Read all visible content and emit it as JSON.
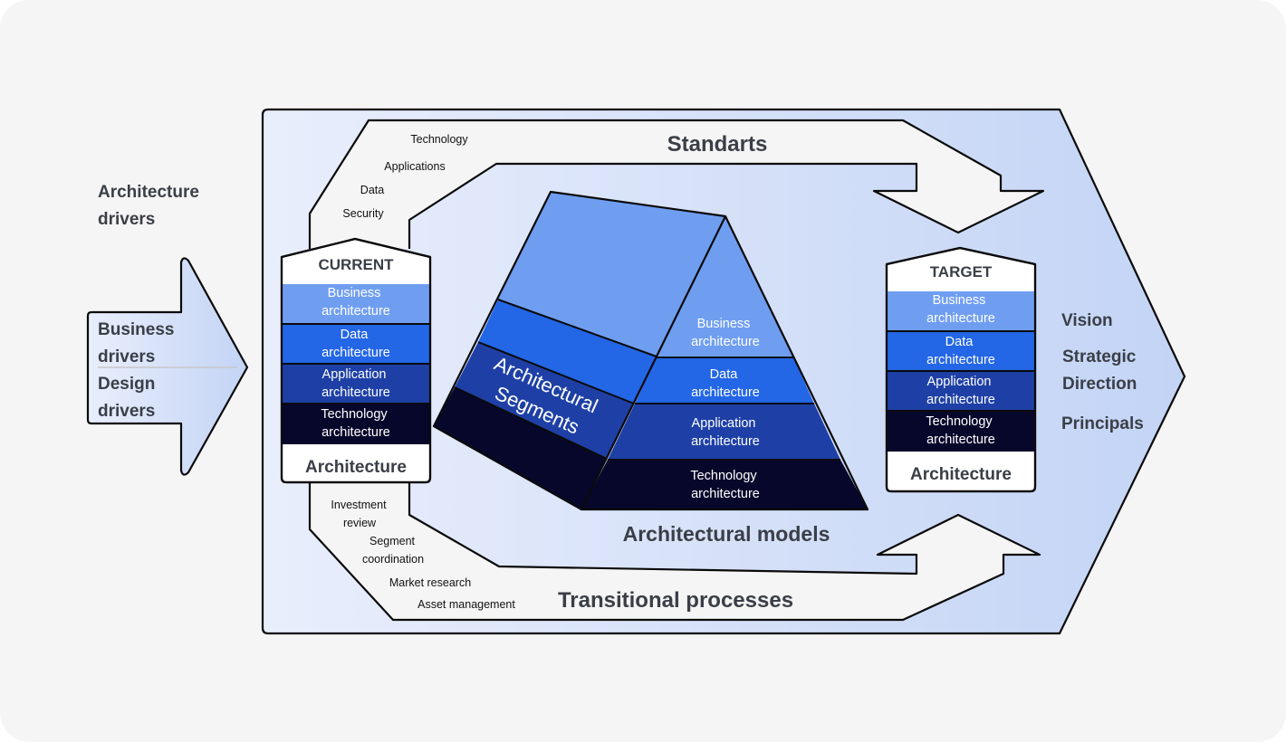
{
  "diagram": {
    "left_panel": {
      "heading_line1": "Architecture",
      "heading_line2": "drivers",
      "arrow_items": [
        {
          "line1": "Business",
          "line2": "drivers"
        },
        {
          "line1": "Design",
          "line2": "drivers"
        }
      ]
    },
    "standards_flow": {
      "title": "Standarts",
      "items": [
        "Technology",
        "Applications",
        "Data",
        "Security"
      ]
    },
    "transitional_flow": {
      "title": "Transitional processes",
      "items": [
        {
          "line1": "Investment",
          "line2": "review"
        },
        {
          "line1": "Segment",
          "line2": "coordination"
        },
        {
          "line1": "Market research",
          "line2": ""
        },
        {
          "line1": "Asset management",
          "line2": ""
        }
      ]
    },
    "current_stack": {
      "header": "CURRENT",
      "footer": "Architecture",
      "layers": [
        {
          "line1": "Business",
          "line2": "architecture",
          "color": "#6f9ef1"
        },
        {
          "line1": "Data",
          "line2": "architecture",
          "color": "#2366e6"
        },
        {
          "line1": "Application",
          "line2": "architecture",
          "color": "#1e40a6"
        },
        {
          "line1": "Technology",
          "line2": "architecture",
          "color": "#07072b"
        }
      ]
    },
    "target_stack": {
      "header": "TARGET",
      "footer": "Architecture",
      "layers": [
        {
          "line1": "Business",
          "line2": "architecture",
          "color": "#6f9ef1"
        },
        {
          "line1": "Data",
          "line2": "architecture",
          "color": "#2366e6"
        },
        {
          "line1": "Application",
          "line2": "architecture",
          "color": "#1e40a6"
        },
        {
          "line1": "Technology",
          "line2": "architecture",
          "color": "#07072b"
        }
      ]
    },
    "pyramid": {
      "caption": "Architectural models",
      "segments_label_line1": "Architectural",
      "segments_label_line2": "Segments",
      "layers": [
        {
          "line1": "Business",
          "line2": "architecture",
          "color": "#6f9ef1"
        },
        {
          "line1": "Data",
          "line2": "architecture",
          "color": "#2366e6"
        },
        {
          "line1": "Application",
          "line2": "architecture",
          "color": "#1e40a6"
        },
        {
          "line1": "Technology",
          "line2": "architecture",
          "color": "#07072b"
        }
      ]
    },
    "right_panel": {
      "items": [
        {
          "line1": "Vision",
          "line2": ""
        },
        {
          "line1": "Strategic",
          "line2": "Direction"
        },
        {
          "line1": "Principals",
          "line2": ""
        }
      ]
    },
    "colors": {
      "background": "#f5f5f5",
      "panel_light": "#e8eefc",
      "panel_dark": "#c5d6f6",
      "text_dark": "#3a3f47"
    }
  }
}
